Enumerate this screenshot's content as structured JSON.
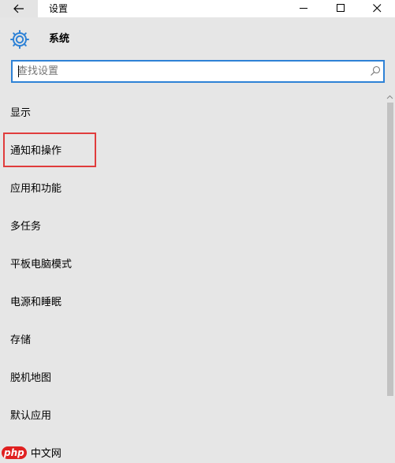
{
  "window": {
    "title": "设置"
  },
  "header": {
    "title": "系统",
    "icon": "gear-icon",
    "accent_color": "#2e82d6"
  },
  "search": {
    "placeholder": "查找设置",
    "value": "",
    "icon": "search-icon"
  },
  "nav": {
    "items": [
      {
        "label": "显示"
      },
      {
        "label": "通知和操作",
        "highlighted": true
      },
      {
        "label": "应用和功能"
      },
      {
        "label": "多任务"
      },
      {
        "label": "平板电脑模式"
      },
      {
        "label": "电源和睡眠"
      },
      {
        "label": "存储"
      },
      {
        "label": "脱机地图"
      },
      {
        "label": "默认应用"
      }
    ]
  },
  "watermark": {
    "badge": "php",
    "text": "中文网"
  },
  "colors": {
    "highlight_border": "#e03c3c",
    "background": "#e6e6e6"
  }
}
